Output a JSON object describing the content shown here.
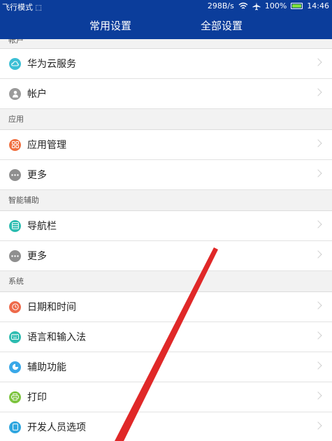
{
  "status": {
    "left_text": "飞行模式",
    "speed": "298B/s",
    "battery": "100%",
    "time": "14:46"
  },
  "tabs": [
    {
      "label": "常用设置",
      "active": false
    },
    {
      "label": "全部设置",
      "active": true
    }
  ],
  "sections": [
    {
      "title": "帐户",
      "items": [
        {
          "label": "华为云服务",
          "icon": "cloud-icon",
          "color": "#3cbfd5"
        },
        {
          "label": "帐户",
          "icon": "person-icon",
          "color": "#9a9a9a"
        }
      ]
    },
    {
      "title": "应用",
      "items": [
        {
          "label": "应用管理",
          "icon": "apps-grid-icon",
          "color": "#f07040"
        },
        {
          "label": "更多",
          "icon": "more-icon",
          "color": "#8f8f8f"
        }
      ]
    },
    {
      "title": "智能辅助",
      "items": [
        {
          "label": "导航栏",
          "icon": "navigation-bar-icon",
          "color": "#2dbcb0"
        },
        {
          "label": "更多",
          "icon": "more-icon",
          "color": "#8f8f8f"
        }
      ]
    },
    {
      "title": "系统",
      "items": [
        {
          "label": "日期和时间",
          "icon": "clock-icon",
          "color": "#ee6a4a"
        },
        {
          "label": "语言和输入法",
          "icon": "keyboard-icon",
          "color": "#2dbcb0"
        },
        {
          "label": "辅助功能",
          "icon": "accessibility-icon",
          "color": "#39a8e8"
        },
        {
          "label": "打印",
          "icon": "printer-icon",
          "color": "#7dc43f"
        },
        {
          "label": "开发人员选项",
          "icon": "developer-icon",
          "color": "#2fa6df"
        }
      ]
    }
  ]
}
